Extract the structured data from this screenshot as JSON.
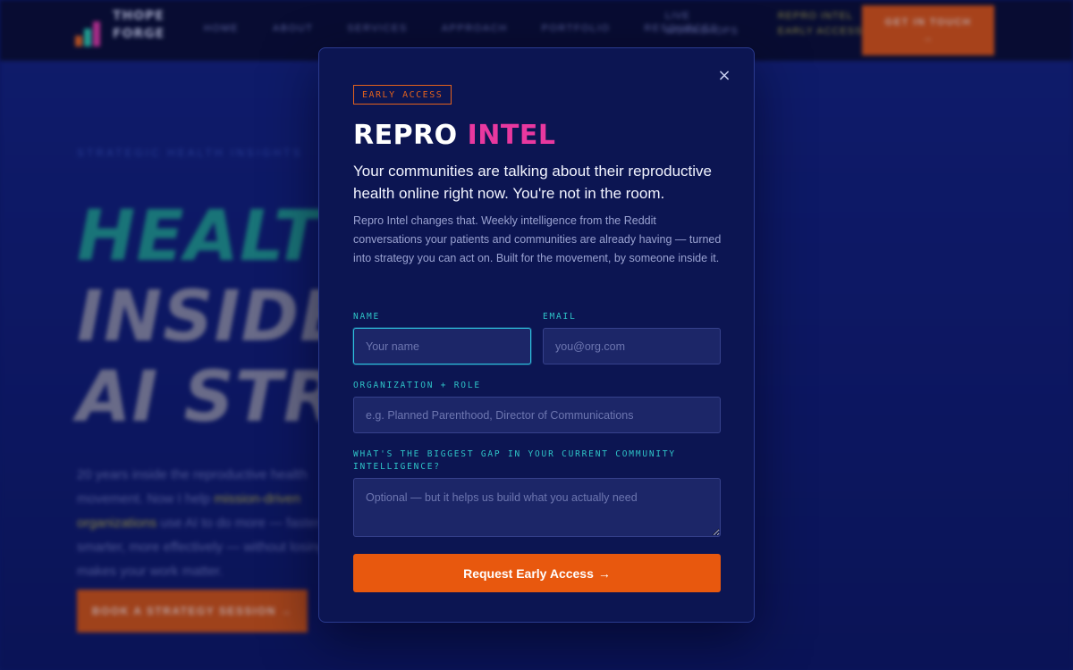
{
  "background": {
    "logo": {
      "line1": "THOPE",
      "line2": "FORGE"
    },
    "nav_links": [
      "HOME",
      "ABOUT",
      "SERVICES",
      "APPROACH",
      "PORTFOLIO",
      "RESOURCES"
    ],
    "nav_extra": [
      {
        "line1": "LIVE",
        "line2": "WORKSHOPS"
      },
      {
        "line1": "REPRO INTEL",
        "line2": "EARLY ACCESS"
      }
    ],
    "nav_cta": {
      "line1": "GET IN TOUCH",
      "line2": "→"
    },
    "eyebrow": "STRATEGIC HEALTH INSIGHTS",
    "headline": {
      "line1": "HEALTH",
      "line2": "INSIDER.",
      "line3": "AI STRATEGY."
    },
    "body_start": "20 years inside the reproductive health movement. Now I help",
    "body_highlight": "mission-driven organizations",
    "body_end": "use AI to do more — faster, smarter, more effectively — without losing what makes your work matter.",
    "cta_label": "BOOK A STRATEGY SESSION →"
  },
  "modal": {
    "close_glyph": "×",
    "badge": "EARLY ACCESS",
    "title_part1": "REPRO ",
    "title_part2": "INTEL",
    "lead": "Your communities are talking about their reproductive health online right now. You're not in the room.",
    "description": "Repro Intel changes that. Weekly intelligence from the Reddit conversations your patients and communities are already having — turned into strategy you can act on. Built for the movement, by someone inside it.",
    "fields": {
      "name": {
        "label": "NAME",
        "placeholder": "Your name",
        "value": ""
      },
      "email": {
        "label": "EMAIL",
        "placeholder": "you@org.com",
        "value": ""
      },
      "organization": {
        "label": "ORGANIZATION + ROLE",
        "placeholder": "e.g. Planned Parenthood, Director of Communications",
        "value": ""
      },
      "gap": {
        "label": "WHAT'S THE BIGGEST GAP IN YOUR CURRENT COMMUNITY INTELLIGENCE?",
        "placeholder": "Optional — but it helps us build what you actually need",
        "value": ""
      }
    },
    "submit_label": "Request Early Access",
    "submit_arrow": "→"
  },
  "colors": {
    "accent_orange": "#e8580e",
    "accent_pink": "#e8389f",
    "accent_teal": "#2ec3c7",
    "modal_bg": "#0c1552",
    "page_bg": "#11217e"
  },
  "icons": {
    "close": "close-icon",
    "arrow": "arrow-right-icon"
  }
}
